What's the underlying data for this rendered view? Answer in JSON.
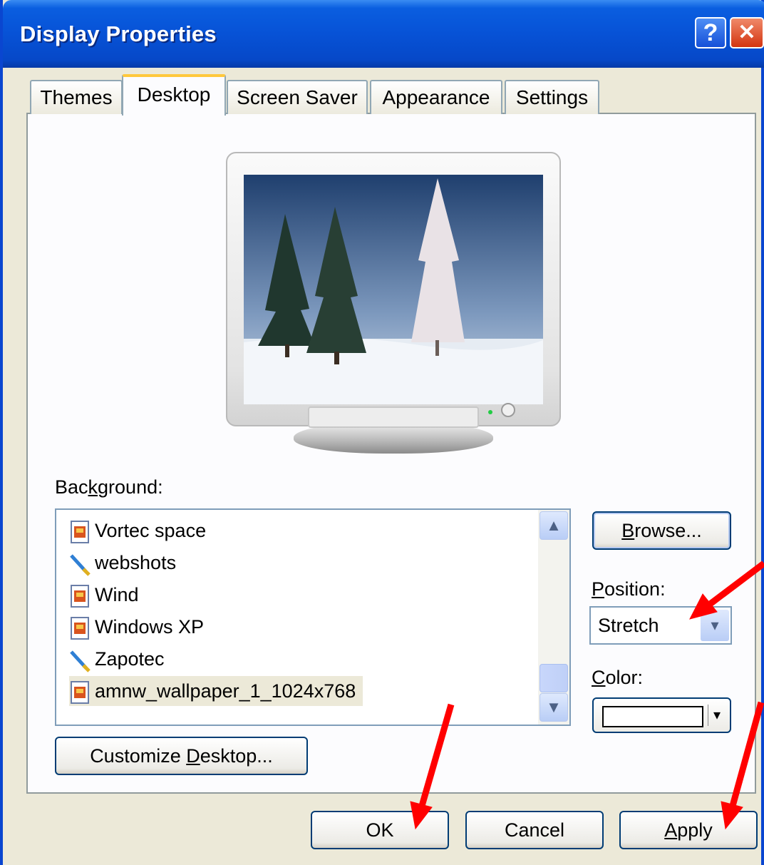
{
  "window": {
    "title": "Display Properties",
    "help_glyph": "?",
    "close_glyph": "✕"
  },
  "tabs": [
    {
      "label": "Themes",
      "active": false
    },
    {
      "label": "Desktop",
      "active": true
    },
    {
      "label": "Screen Saver",
      "active": false
    },
    {
      "label": "Appearance",
      "active": false
    },
    {
      "label": "Settings",
      "active": false
    }
  ],
  "background": {
    "label_pre": "Bac",
    "label_key": "k",
    "label_post": "ground:",
    "items": [
      {
        "label": "Vortec space",
        "icon": "image-file-icon"
      },
      {
        "label": "webshots",
        "icon": "brush-icon"
      },
      {
        "label": "Wind",
        "icon": "image-file-icon"
      },
      {
        "label": "Windows XP",
        "icon": "image-file-icon"
      },
      {
        "label": "Zapotec",
        "icon": "brush-icon"
      },
      {
        "label": "amnw_wallpaper_1_1024x768",
        "icon": "image-file-icon",
        "selected": true
      }
    ],
    "scroll_up": "▲",
    "scroll_down": "▼"
  },
  "browse": {
    "pre": "",
    "key": "B",
    "post": "rowse..."
  },
  "position": {
    "label_key": "P",
    "label_post": "osition:",
    "value": "Stretch",
    "arrow": "▾"
  },
  "color": {
    "label_key": "C",
    "label_post": "olor:",
    "value": "#ffffff",
    "caret": "▾"
  },
  "customize": {
    "pre": "Customize ",
    "key": "D",
    "post": "esktop..."
  },
  "footer": {
    "ok": "OK",
    "cancel": "Cancel",
    "apply_key": "A",
    "apply_post": "pply"
  },
  "annotation_color": "#ff0000"
}
